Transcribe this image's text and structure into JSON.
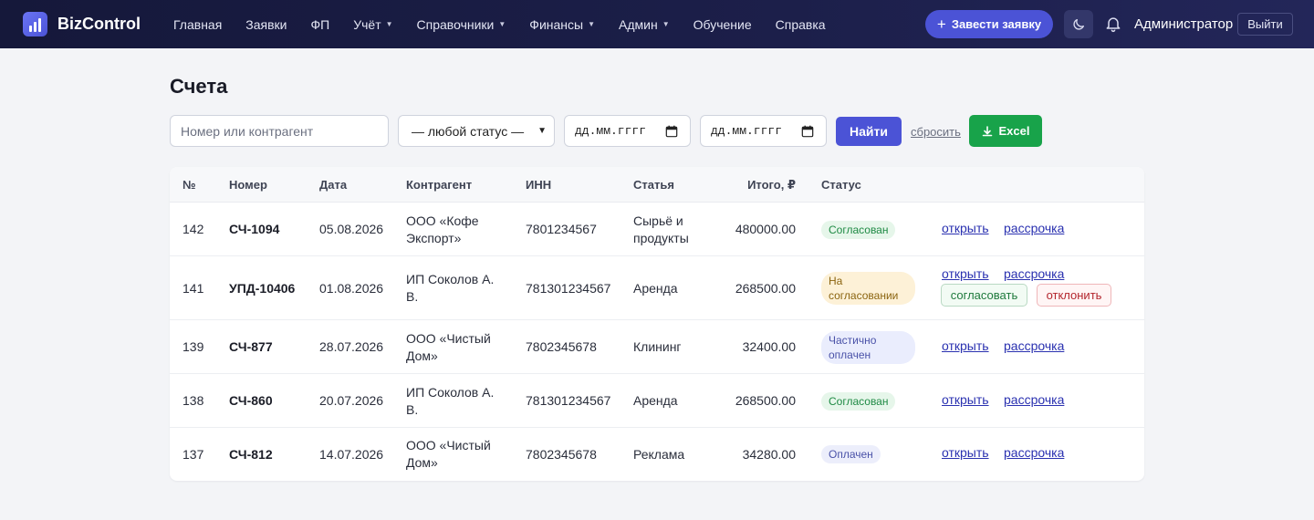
{
  "navbar": {
    "brand": "BizControl",
    "menu": [
      {
        "label": "Главная",
        "dropdown": false
      },
      {
        "label": "Заявки",
        "dropdown": false
      },
      {
        "label": "ФП",
        "dropdown": false
      },
      {
        "label": "Учёт",
        "dropdown": true
      },
      {
        "label": "Справочники",
        "dropdown": true
      },
      {
        "label": "Финансы",
        "dropdown": true
      },
      {
        "label": "Админ",
        "dropdown": true
      },
      {
        "label": "Обучение",
        "dropdown": false
      },
      {
        "label": "Справка",
        "dropdown": false
      }
    ],
    "new_request": "Завести заявку",
    "user": "Администратор",
    "logout": "Выйти"
  },
  "page": {
    "title": "Счета"
  },
  "filters": {
    "search_placeholder": "Номер или контрагент",
    "status_value": "— любой статус —",
    "date_from_placeholder": "дд.мм.гггг",
    "date_to_placeholder": "дд.мм.гггг",
    "find": "Найти",
    "reset": "сбросить",
    "excel": "Excel"
  },
  "table": {
    "headers": {
      "id": "№",
      "number": "Номер",
      "date": "Дата",
      "counterparty": "Контрагент",
      "inn": "ИНН",
      "article": "Статья",
      "total": "Итого, ₽",
      "status": "Статус"
    },
    "rows": [
      {
        "id": "142",
        "number": "СЧ-1094",
        "date": "05.08.2026",
        "counterparty": [
          "ООО «Кофе",
          "Экспорт»"
        ],
        "inn": "7801234567",
        "article": [
          "Сырьё и",
          "продукты"
        ],
        "total": "480000.00",
        "status": [
          "Согласован"
        ],
        "status_type": "green",
        "actions": {
          "open": "открыть",
          "installment": "рассрочка"
        }
      },
      {
        "id": "141",
        "number": "УПД-10406",
        "date": "01.08.2026",
        "counterparty": [
          "ИП Соколов А.",
          "В."
        ],
        "inn": "781301234567",
        "article": [
          "Аренда"
        ],
        "total": "268500.00",
        "status": [
          "На",
          "согласовании"
        ],
        "status_type": "yellow",
        "actions": {
          "open": "открыть",
          "installment": "рассрочка",
          "approve": "согласовать",
          "reject": "отклонить"
        }
      },
      {
        "id": "139",
        "number": "СЧ-877",
        "date": "28.07.2026",
        "counterparty": [
          "ООО «Чистый",
          "Дом»"
        ],
        "inn": "7802345678",
        "article": [
          "Клининг"
        ],
        "total": "32400.00",
        "status": [
          "Частично",
          "оплачен"
        ],
        "status_type": "blue",
        "actions": {
          "open": "открыть",
          "installment": "рассрочка"
        }
      },
      {
        "id": "138",
        "number": "СЧ-860",
        "date": "20.07.2026",
        "counterparty": [
          "ИП Соколов А.",
          "В."
        ],
        "inn": "781301234567",
        "article": [
          "Аренда"
        ],
        "total": "268500.00",
        "status": [
          "Согласован"
        ],
        "status_type": "green",
        "actions": {
          "open": "открыть",
          "installment": "рассрочка"
        }
      },
      {
        "id": "137",
        "number": "СЧ-812",
        "date": "14.07.2026",
        "counterparty": [
          "ООО «Чистый",
          "Дом»"
        ],
        "inn": "7802345678",
        "article": [
          "Реклама"
        ],
        "total": "34280.00",
        "status": [
          "Оплачен"
        ],
        "status_type": "lilac",
        "actions": {
          "open": "открыть",
          "installment": "рассрочка"
        }
      }
    ]
  }
}
